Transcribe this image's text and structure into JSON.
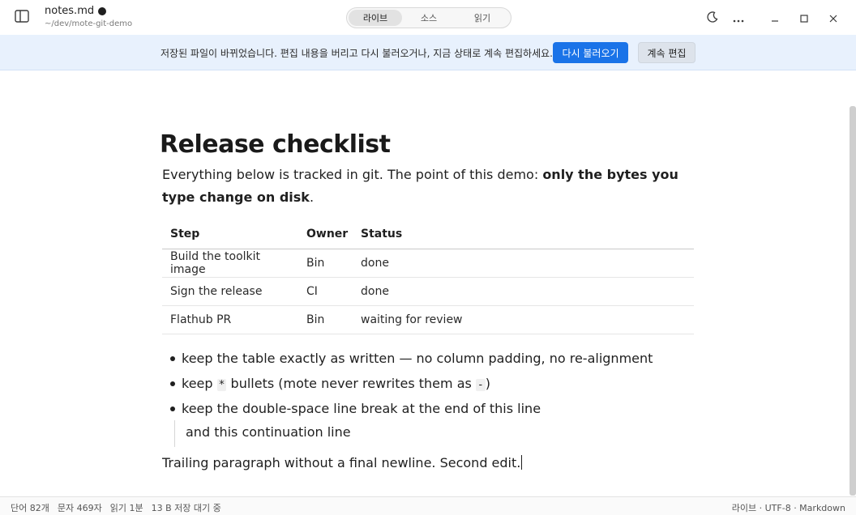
{
  "header": {
    "file_name": "notes.md",
    "file_path": "~/dev/mote-git-demo",
    "modes": [
      "라이브",
      "소스",
      "읽기"
    ],
    "active_mode": "라이브"
  },
  "banner": {
    "message": "저장된 파일이 바뀌었습니다. 편집 내용을 버리고 다시 불러오거나, 지금 상태로 계속 편집하세요.",
    "reload_label": "다시 불러오기",
    "keep_label": "계속 편집",
    "accent": "#1a73e8",
    "background": "#e8f1fd"
  },
  "document": {
    "title": "Release checklist",
    "intro_plain": "Everything below is tracked in git. The point of this demo: ",
    "intro_bold": "only the bytes you type change on disk",
    "intro_end": ".",
    "table": {
      "headers": [
        "Step",
        "Owner",
        "Status"
      ],
      "rows": [
        [
          "Build the toolkit image",
          "Bin",
          "done"
        ],
        [
          "Sign the release",
          "CI",
          "done"
        ],
        [
          "Flathub PR",
          "Bin",
          "waiting for review"
        ]
      ]
    },
    "bullet1": "keep the table exactly as written — no column padding, no re-alignment",
    "bullet2_pre": "keep ",
    "bullet2_code1": "*",
    "bullet2_mid": " bullets (mote never rewrites them as ",
    "bullet2_code2": "-",
    "bullet2_end": ")",
    "bullet3": "keep the double-space line break at the end of this line",
    "continuation": "and this continuation line",
    "trailing": "Trailing paragraph without a final newline. Second edit."
  },
  "status": {
    "words": "단어 82개",
    "chars": "문자 469자",
    "read_time": "읽기 1분",
    "save_state": "13 B 저장 대기 중",
    "right": "라이브 · UTF-8 · Markdown"
  },
  "icons": [
    "sidebar-icon",
    "moon-icon",
    "more-icon",
    "minimize-icon",
    "maximize-icon",
    "close-icon"
  ]
}
